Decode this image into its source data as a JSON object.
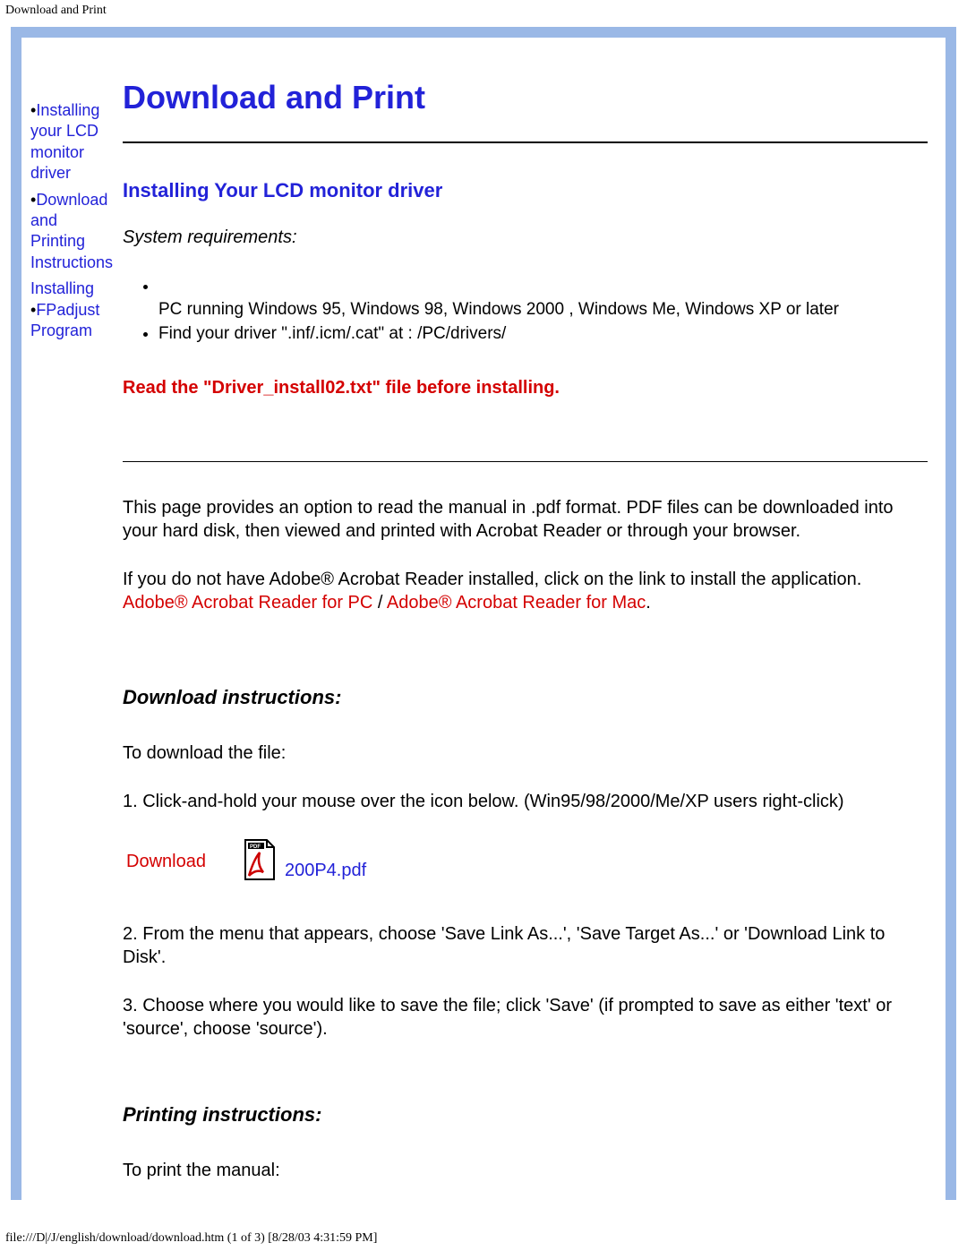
{
  "header": {
    "small_title": "Download and Print"
  },
  "sidebar": {
    "items": [
      {
        "label": "Installing your LCD monitor driver"
      },
      {
        "label": "Download and Printing Instructions"
      },
      {
        "label": "Installing FPadjust Program"
      }
    ]
  },
  "main": {
    "page_title": "Download and Print",
    "section_title": "Installing Your LCD monitor driver",
    "sys_req_label": "System requirements:",
    "req_items": [
      "PC running Windows 95, Windows 98, Windows 2000 , Windows Me, Windows XP or later",
      "Find your driver \".inf/.icm/.cat\" at : /PC/drivers/"
    ],
    "warning": "Read the \"Driver_install02.txt\" file before installing.",
    "para_pdf": "This page provides an option to read the manual in .pdf format. PDF files can be downloaded into your hard disk, then viewed and printed with Acrobat Reader or through your browser.",
    "para_reader_1": "If you do not have Adobe® Acrobat Reader installed, click on the link to install the application. ",
    "link_reader_pc": "Adobe® Acrobat Reader for PC",
    "reader_sep": " / ",
    "link_reader_mac": "Adobe® Acrobat Reader for Mac",
    "reader_end": ".",
    "dl_instr_title": "Download instructions:",
    "dl_instr_intro": "To download the file:",
    "dl_step1": "1. Click-and-hold your mouse over the icon below. (Win95/98/2000/Me/XP users right-click)",
    "dl_label": "Download",
    "pdf_name": "200P4.pdf",
    "dl_step2": "2. From the menu that appears, choose 'Save Link As...', 'Save Target As...' or 'Download Link to Disk'.",
    "dl_step3": "3. Choose where you would like to save the file; click 'Save' (if prompted to save as either 'text' or 'source', choose 'source').",
    "print_title": "Printing instructions:",
    "print_intro": "To print the manual:"
  },
  "footer": {
    "path": "file:///D|/J/english/download/download.htm (1 of 3) [8/28/03 4:31:59 PM]"
  }
}
